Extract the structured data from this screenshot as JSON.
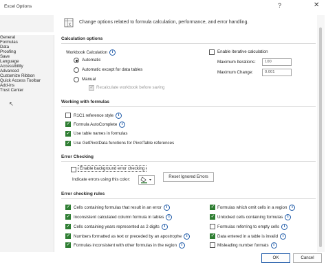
{
  "window": {
    "title": "Excel Options",
    "help": "?",
    "close": "✕"
  },
  "sidebar": {
    "items": [
      {
        "label": "General"
      },
      {
        "label": "Formulas"
      },
      {
        "label": "Data"
      },
      {
        "label": "Proofing"
      },
      {
        "label": "Save"
      },
      {
        "label": "Language"
      },
      {
        "label": "Accessibility"
      },
      {
        "label": "Advanced"
      },
      {
        "label": "Customize Ribbon"
      },
      {
        "label": "Quick Access Toolbar"
      },
      {
        "label": "Add-ins"
      },
      {
        "label": "Trust Center"
      }
    ],
    "selected": "Formulas"
  },
  "header": {
    "text": "Change options related to formula calculation, performance, and error handling."
  },
  "calculation": {
    "title": "Calculation options",
    "workbook_label": "Workbook Calculation",
    "radios": [
      {
        "label": "Automatic",
        "selected": true
      },
      {
        "label": "Automatic except for data tables",
        "selected": false
      },
      {
        "label": "Manual",
        "selected": false
      }
    ],
    "recalc_label": "Recalculate workbook before saving",
    "iterative_label": "Enable iterative calculation",
    "max_iter_label": "Maximum Iterations:",
    "max_iter_value": "100",
    "max_change_label": "Maximum Change:",
    "max_change_value": "0.001"
  },
  "working": {
    "title": "Working with formulas",
    "items": [
      {
        "label": "R1C1 reference style",
        "checked": false,
        "info": true
      },
      {
        "label": "Formula AutoComplete",
        "checked": true,
        "info": true
      },
      {
        "label": "Use table names in formulas",
        "checked": true,
        "info": false
      },
      {
        "label": "Use GetPivotData functions for PivotTable references",
        "checked": true,
        "info": false
      }
    ]
  },
  "error_checking": {
    "title": "Error Checking",
    "enable_label": "Enable background error checking",
    "indicate_label": "Indicate errors using this color:",
    "reset_button": "Reset Ignored Errors"
  },
  "rules": {
    "title": "Error checking rules",
    "left": [
      "Cells containing formulas that result in an error",
      "Inconsistent calculated column formula in tables",
      "Cells containing years represented as 2 digits",
      "Numbers formatted as text or preceded by an apostrophe",
      "Formulas inconsistent with other formulas in the region"
    ],
    "right": [
      {
        "label": "Formulas which omit cells in a region",
        "checked": true
      },
      {
        "label": "Unlocked cells containing formulas",
        "checked": true
      },
      {
        "label": "Formulas referring to empty cells",
        "checked": false
      },
      {
        "label": "Data entered in a table is invalid",
        "checked": true
      },
      {
        "label": "Misleading number formats",
        "checked": false
      }
    ]
  },
  "footer": {
    "ok": "OK",
    "cancel": "Cancel"
  },
  "colors": {
    "accent": "#1e5aa8",
    "check": "#2e7d32"
  }
}
